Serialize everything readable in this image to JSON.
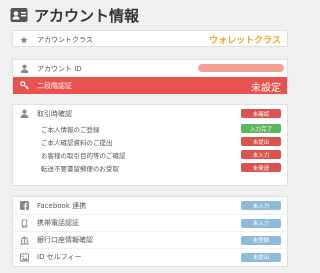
{
  "header": {
    "title": "アカウント情報"
  },
  "account_class": {
    "label": "アカウントクラス",
    "value": "ウォレットクラス"
  },
  "account_id": {
    "label": "アカウント ID"
  },
  "two_factor": {
    "label": "二段階認証",
    "value": "未設定"
  },
  "verification": {
    "label": "取引時確認",
    "status": "未確認",
    "items": [
      {
        "label": "ご本人情報のご登録",
        "status": "入力完了",
        "color": "green"
      },
      {
        "label": "ご本人確認資料のご提出",
        "status": "未提出",
        "color": "red"
      },
      {
        "label": "お客様の取引目的等のご確認",
        "status": "未入力",
        "color": "red"
      },
      {
        "label": "転送不要書留郵便のお受取",
        "status": "未発送",
        "color": "red"
      }
    ]
  },
  "links": [
    {
      "label": "Facebook 連携",
      "status": "未入力",
      "icon": "facebook-icon"
    },
    {
      "label": "携帯電話認証",
      "status": "未入力",
      "icon": "phone-icon"
    },
    {
      "label": "銀行口座情報確認",
      "status": "未登録",
      "icon": "bank-icon"
    },
    {
      "label": "ID セルフィー",
      "status": "未提出",
      "icon": "image-icon"
    }
  ],
  "colors": {
    "accent": "#f0a71f",
    "alert": "#e8534f",
    "danger": "#d9534f",
    "success": "#5cb85c",
    "info": "#8dbbd9"
  }
}
